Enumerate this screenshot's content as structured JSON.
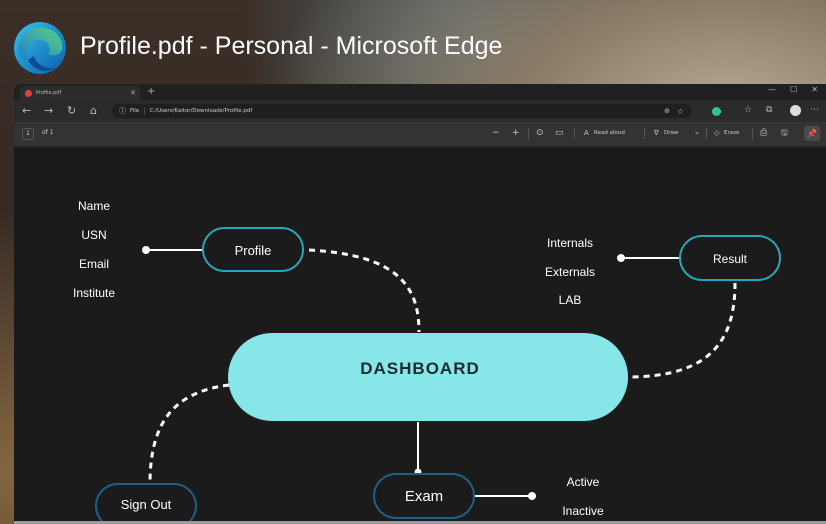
{
  "window": {
    "title": "Profile.pdf - Personal - Microsoft Edge"
  },
  "tab": {
    "title": "Profile.pdf",
    "close": "✕",
    "new_tab": "+"
  },
  "window_controls": {
    "minimize": "—",
    "maximize": "☐",
    "close": "✕"
  },
  "address": {
    "back": "←",
    "forward": "→",
    "refresh": "↻",
    "home": "⌂",
    "info": "ⓘ",
    "label": "File",
    "separator": "|",
    "url": "C:/Users/Kaitor/Downloads/Profile.pdf",
    "zoom": "⊕",
    "favorite": "☆"
  },
  "browser_icons": {
    "favorites": "☆",
    "collections": "⧉",
    "menu": "⋯"
  },
  "pdf_toolbar": {
    "page_number": "1",
    "page_of": "of 1",
    "zoom_out": "−",
    "zoom_in": "+",
    "fit": "⊙",
    "page_view": "▭",
    "read_aloud_icon": "A",
    "read_aloud": "Read aloud",
    "draw_icon": "∇",
    "draw": "Draw",
    "draw_dropdown": "⌄",
    "erase_icon": "◇",
    "erase": "Erase",
    "print": "⎙",
    "save": "🖫",
    "pin": "📌"
  },
  "diagram": {
    "center": "DASHBOARD",
    "nodes": {
      "profile": "Profile",
      "result": "Result",
      "exam": "Exam",
      "sign_out": "Sign Out"
    },
    "profile_items": [
      "Name",
      "USN",
      "Email",
      "Institute"
    ],
    "result_items": [
      "Internals",
      "Externals",
      "LAB"
    ],
    "exam_items": [
      "Active",
      "Inactive"
    ],
    "colors": {
      "center_fill": "#86e6e8",
      "center_text": "#1e2a30",
      "node_border": "#2aa5b8",
      "line": "#ffffff",
      "background": "#1b1b1b"
    }
  }
}
